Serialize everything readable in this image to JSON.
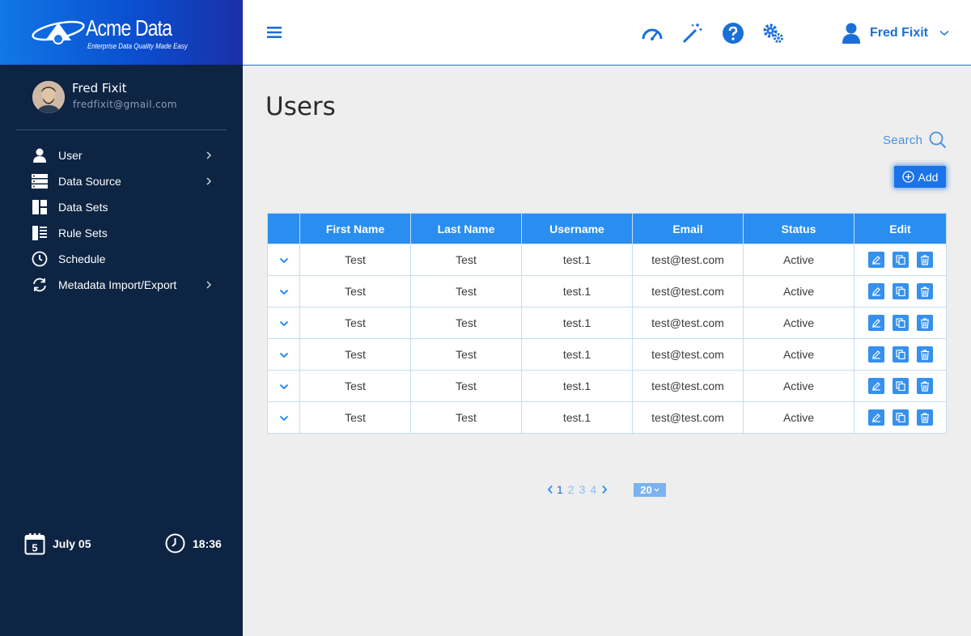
{
  "brand": {
    "name": "Acme Data",
    "tagline": "Enterprise Data Quality Made Easy"
  },
  "profile": {
    "name": "Fred Fixit",
    "email": "fredfixit@gmail.com"
  },
  "sidebar": {
    "items": [
      {
        "label": "User",
        "icon": "user-icon",
        "has_submenu": true
      },
      {
        "label": "Data Source",
        "icon": "server-icon",
        "has_submenu": true
      },
      {
        "label": "Data Sets",
        "icon": "dashboard-icon",
        "has_submenu": false
      },
      {
        "label": "Rule Sets",
        "icon": "list-icon",
        "has_submenu": false
      },
      {
        "label": "Schedule",
        "icon": "clock-icon",
        "has_submenu": false
      },
      {
        "label": "Metadata Import/Export",
        "icon": "sync-icon",
        "has_submenu": true
      }
    ],
    "date": "July 05",
    "calendar_day": "5",
    "time": "18:36"
  },
  "topbar": {
    "user_name": "Fred Fixit",
    "icons": [
      "speedometer-icon",
      "magic-wand-icon",
      "help-icon",
      "settings-icon"
    ]
  },
  "main": {
    "title": "Users",
    "search_label": "Search",
    "add_label": "Add"
  },
  "table": {
    "columns": [
      "First Name",
      "Last Name",
      "Username",
      "Email",
      "Status",
      "Edit"
    ],
    "rows": [
      {
        "first": "Test",
        "last": "Test",
        "username": "test.1",
        "email": "test@test.com",
        "status": "Active"
      },
      {
        "first": "Test",
        "last": "Test",
        "username": "test.1",
        "email": "test@test.com",
        "status": "Active"
      },
      {
        "first": "Test",
        "last": "Test",
        "username": "test.1",
        "email": "test@test.com",
        "status": "Active"
      },
      {
        "first": "Test",
        "last": "Test",
        "username": "test.1",
        "email": "test@test.com",
        "status": "Active"
      },
      {
        "first": "Test",
        "last": "Test",
        "username": "test.1",
        "email": "test@test.com",
        "status": "Active"
      },
      {
        "first": "Test",
        "last": "Test",
        "username": "test.1",
        "email": "test@test.com",
        "status": "Active"
      }
    ]
  },
  "pagination": {
    "pages": [
      "1",
      "2",
      "3",
      "4"
    ],
    "current": "1",
    "page_size": "20"
  },
  "colors": {
    "accent": "#1a73e8",
    "header_blue": "#2a8ef0",
    "sidebar_bg": "#0d2443",
    "link_blue": "#1a6fd8"
  }
}
